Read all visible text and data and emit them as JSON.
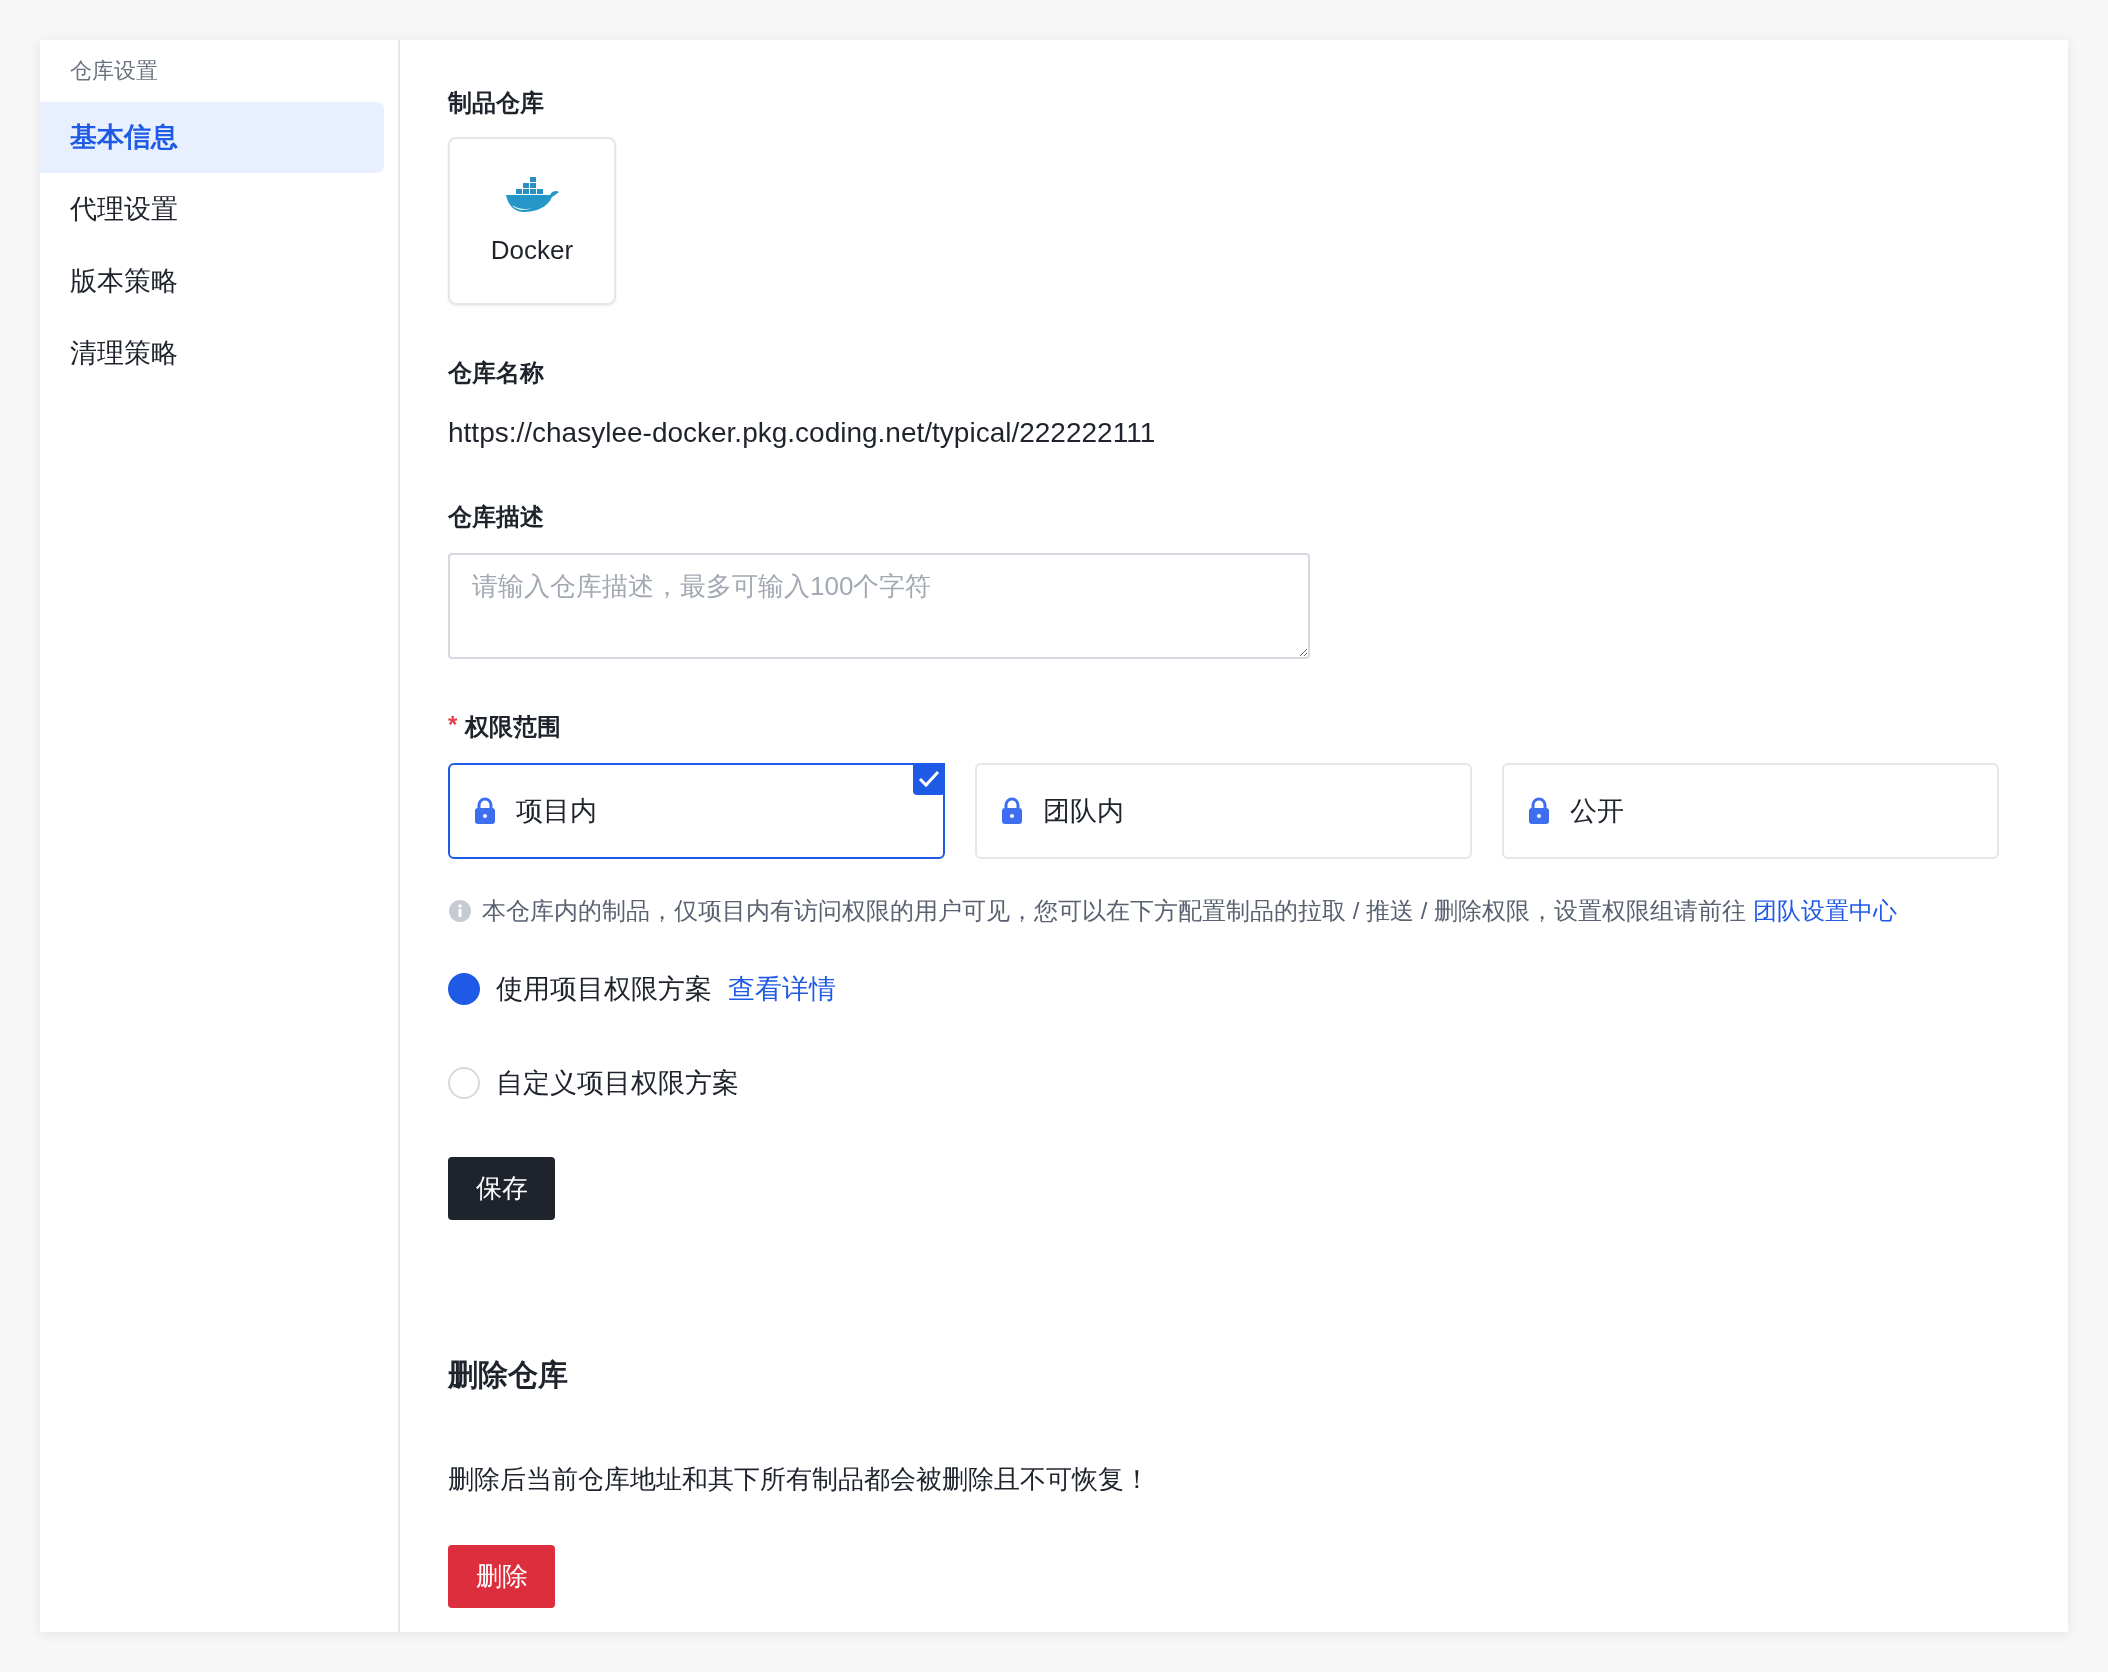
{
  "sidebar": {
    "title": "仓库设置",
    "items": [
      {
        "label": "基本信息",
        "selected": true
      },
      {
        "label": "代理设置",
        "selected": false
      },
      {
        "label": "版本策略",
        "selected": false
      },
      {
        "label": "清理策略",
        "selected": false
      }
    ]
  },
  "artifact": {
    "label": "制品仓库",
    "type_name": "Docker"
  },
  "repo_name": {
    "label": "仓库名称",
    "value": "https://chasylee-docker.pkg.coding.net/typical/222222111"
  },
  "description": {
    "label": "仓库描述",
    "placeholder": "请输入仓库描述，最多可输入100个字符"
  },
  "permission": {
    "required_mark": "*",
    "label": "权限范围",
    "options": [
      {
        "label": "项目内",
        "selected": true
      },
      {
        "label": "团队内",
        "selected": false
      },
      {
        "label": "公开",
        "selected": false
      }
    ],
    "info": "本仓库内的制品，仅项目内有访问权限的用户可见，您可以在下方配置制品的拉取 / 推送 / 删除权限，设置权限组请前往",
    "info_link": "团队设置中心",
    "schemes": [
      {
        "label": "使用项目权限方案",
        "link": "查看详情",
        "selected": true
      },
      {
        "label": "自定义项目权限方案",
        "selected": false
      }
    ]
  },
  "save_button": "保存",
  "delete_section": {
    "title": "删除仓库",
    "warning": "删除后当前仓库地址和其下所有制品都会被删除且不可恢复！",
    "button": "删除"
  }
}
